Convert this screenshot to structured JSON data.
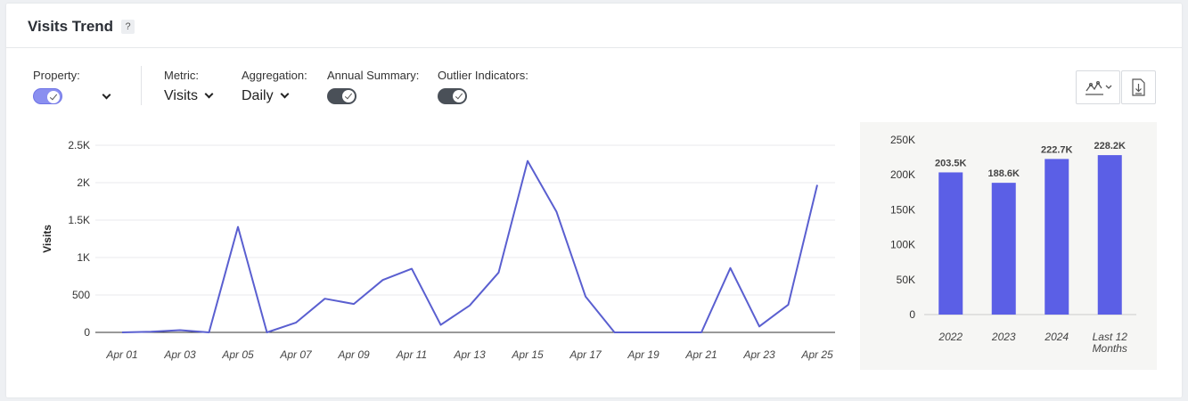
{
  "header": {
    "title": "Visits Trend",
    "help": "?"
  },
  "controls": {
    "property_label": "Property:",
    "metric_label": "Metric:",
    "metric_value": "Visits",
    "aggregation_label": "Aggregation:",
    "aggregation_value": "Daily",
    "annual_summary_label": "Annual Summary:",
    "outlier_label": "Outlier Indicators:"
  },
  "colors": {
    "accent": "#5b5fe6",
    "line": "#5a5fd0",
    "toggle_on_property": "#8a8ff0",
    "toggle_dark": "#4a5058"
  },
  "icons": {
    "chart_type": "line-chart-icon",
    "download": "download-icon"
  },
  "chart_data": [
    {
      "type": "line",
      "ylabel": "Visits",
      "ylim": [
        0,
        2500
      ],
      "yticks": [
        0,
        500,
        1000,
        1500,
        2000,
        2500
      ],
      "ytick_labels": [
        "0",
        "500",
        "1K",
        "1.5K",
        "2K",
        "2.5K"
      ],
      "x": [
        "Apr 01",
        "Apr 02",
        "Apr 03",
        "Apr 04",
        "Apr 05",
        "Apr 06",
        "Apr 07",
        "Apr 08",
        "Apr 09",
        "Apr 10",
        "Apr 11",
        "Apr 12",
        "Apr 13",
        "Apr 14",
        "Apr 15",
        "Apr 16",
        "Apr 17",
        "Apr 18",
        "Apr 19",
        "Apr 20",
        "Apr 21",
        "Apr 22",
        "Apr 23",
        "Apr 24",
        "Apr 25"
      ],
      "xtick_labels": [
        "Apr 01",
        "Apr 03",
        "Apr 05",
        "Apr 07",
        "Apr 09",
        "Apr 11",
        "Apr 13",
        "Apr 15",
        "Apr 17",
        "Apr 19",
        "Apr 21",
        "Apr 23",
        "Apr 25"
      ],
      "values": [
        0,
        10,
        30,
        0,
        1410,
        0,
        130,
        450,
        380,
        700,
        850,
        100,
        360,
        800,
        2290,
        1610,
        480,
        0,
        0,
        0,
        0,
        860,
        80,
        370,
        1970
      ],
      "grid": true
    },
    {
      "type": "bar",
      "categories": [
        "2022",
        "2023",
        "2024",
        "Last 12 Months"
      ],
      "category_lines": [
        [
          "2022"
        ],
        [
          "2023"
        ],
        [
          "2024"
        ],
        [
          "Last 12",
          "Months"
        ]
      ],
      "values": [
        203500,
        188600,
        222700,
        228200
      ],
      "data_labels": [
        "203.5K",
        "188.6K",
        "222.7K",
        "228.2K"
      ],
      "ylim": [
        0,
        250000
      ],
      "yticks": [
        0,
        50000,
        100000,
        150000,
        200000,
        250000
      ],
      "ytick_labels": [
        "0",
        "50K",
        "100K",
        "150K",
        "200K",
        "250K"
      ],
      "color": "#5b5fe6"
    }
  ]
}
